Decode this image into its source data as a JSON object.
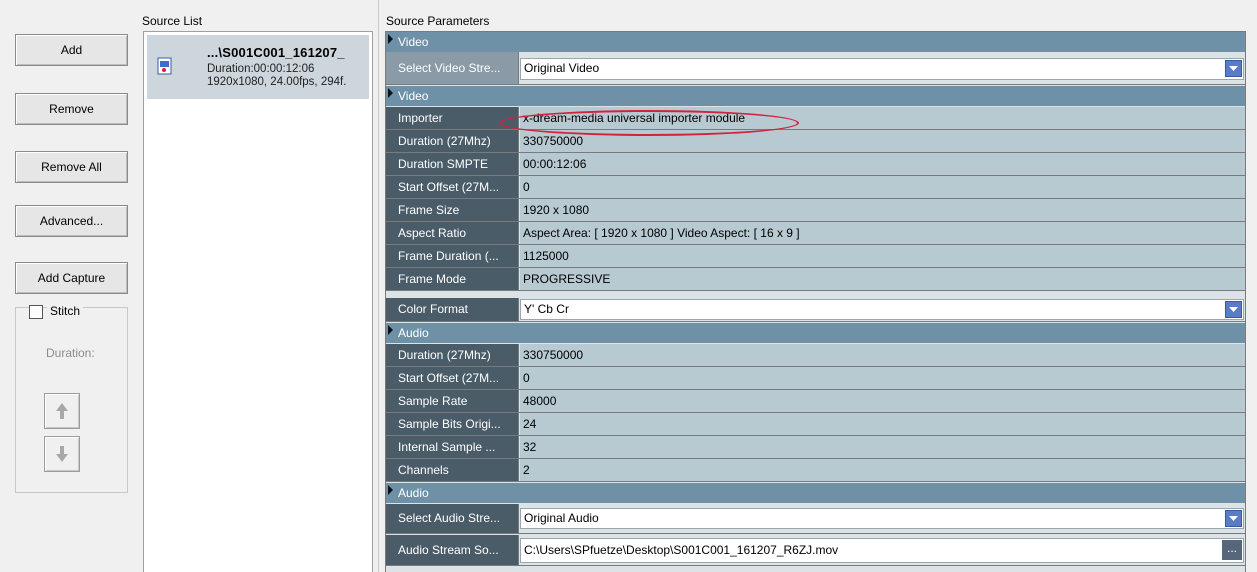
{
  "buttons": {
    "add_label": "Add",
    "remove_label": "Remove",
    "remove_all_label": "Remove All",
    "advanced_label": "Advanced...",
    "add_capture_label": "Add Capture"
  },
  "stitch": {
    "label": "Stitch",
    "checked": false,
    "duration_label": "Duration:"
  },
  "source_list": {
    "title": "Source List",
    "items": [
      {
        "name": "...\\S001C001_161207_",
        "duration": "Duration:00:00:12:06",
        "info": "1920x1080, 24.00fps, 294f."
      }
    ]
  },
  "source_parameters": {
    "title": "Source Parameters",
    "video_header": "Video",
    "select_video_stream": {
      "name": "Select Video Stre...",
      "value": "Original Video"
    },
    "video_section": "Video",
    "video_rows": [
      {
        "name": "Importer",
        "value": "x-dream-media universal importer module"
      },
      {
        "name": "Duration (27Mhz)",
        "value": "330750000"
      },
      {
        "name": "Duration SMPTE",
        "value": "00:00:12:06"
      },
      {
        "name": "Start Offset (27M...",
        "value": "0"
      },
      {
        "name": "Frame Size",
        "value": "1920 x 1080"
      },
      {
        "name": "Aspect Ratio",
        "value": "Aspect Area: [ 1920 x 1080 ]   Video Aspect: [ 16 x 9 ]"
      },
      {
        "name": "Frame Duration (...",
        "value": "1125000"
      },
      {
        "name": "Frame Mode",
        "value": "PROGRESSIVE"
      }
    ],
    "color_format": {
      "name": "Color Format",
      "value": "Y' Cb Cr"
    },
    "audio_section": "Audio",
    "audio_rows": [
      {
        "name": "Duration (27Mhz)",
        "value": "330750000"
      },
      {
        "name": "Start Offset (27M...",
        "value": "0"
      },
      {
        "name": "Sample Rate",
        "value": "48000"
      },
      {
        "name": "Sample Bits Origi...",
        "value": "24"
      },
      {
        "name": "Internal Sample ...",
        "value": "32"
      },
      {
        "name": "Channels",
        "value": "2"
      }
    ],
    "audio_header": "Audio",
    "select_audio_stream": {
      "name": "Select Audio Stre...",
      "value": "Original Audio"
    },
    "audio_stream_source": {
      "name": "Audio Stream So...",
      "value": "C:\\Users\\SPfuetze\\Desktop\\S001C001_161207_R6ZJ.mov",
      "button": "..."
    }
  },
  "colors": {
    "category_header": "#6f91a8",
    "name_cell": "#4a5c68",
    "value_cell": "#b7c9d1",
    "highlight": "#d2233c"
  }
}
